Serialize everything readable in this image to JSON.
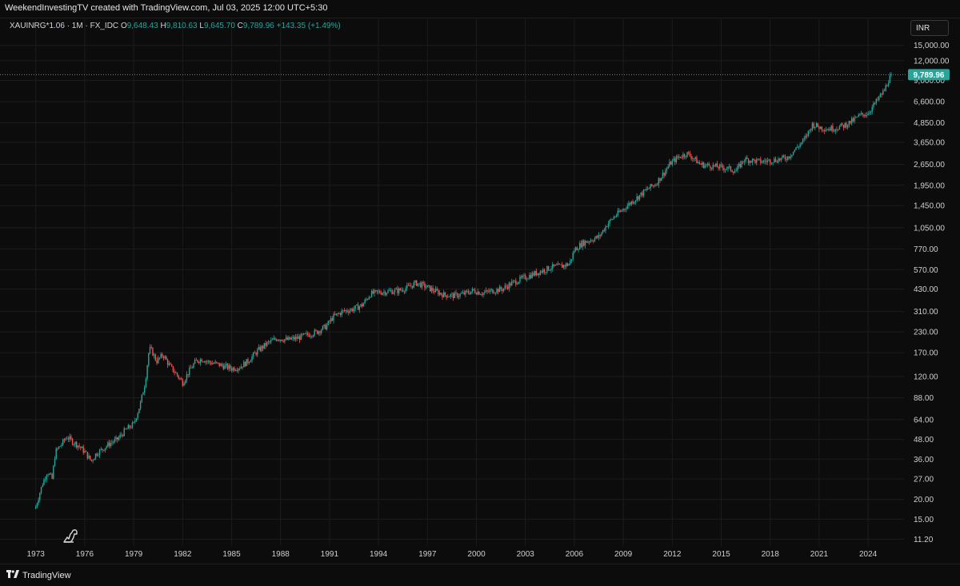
{
  "header": {
    "credit": "WeekendInvestingTV created with TradingView.com, Jul 03, 2025 12:00 UTC+5:30"
  },
  "legend": {
    "symbol": "XAUINRG*1.06 · 1M · FX_IDC",
    "open_label": "O",
    "open_value": "9,648.43",
    "high_label": "H",
    "high_value": "9,810.63",
    "low_label": "L",
    "low_value": "9,645.70",
    "close_label": "C",
    "close_value": "9,789.96",
    "change": "+143.35 (+1.49%)"
  },
  "currency_button": "INR",
  "footer": {
    "brand": "TradingView"
  },
  "colors": {
    "up": "#26a69a",
    "down": "#ef5350",
    "background": "#0c0c0c",
    "grid": "#1c1c1c",
    "price_tag": "#26a69a"
  },
  "icons": [
    "tradingview-logo-icon",
    "dino-icon"
  ],
  "chart_data": {
    "type": "candlestick",
    "scale": "log",
    "interval": "1M",
    "symbol": "XAUINRG*1.06",
    "currency": "INR",
    "last_price": 9789.96,
    "last_price_label": "9,789.96",
    "y_ticks": [
      "15,000.00",
      "12,000.00",
      "9,000.00",
      "6,600.00",
      "4,850.00",
      "3,650.00",
      "2,650.00",
      "1,950.00",
      "1,450.00",
      "1,050.00",
      "770.00",
      "570.00",
      "430.00",
      "310.00",
      "230.00",
      "170.00",
      "120.00",
      "88.00",
      "64.00",
      "48.00",
      "36.00",
      "27.00",
      "20.00",
      "15.00",
      "11.20"
    ],
    "y_values": [
      15000,
      12000,
      9000,
      6600,
      4850,
      3650,
      2650,
      1950,
      1450,
      1050,
      770,
      570,
      430,
      310,
      230,
      170,
      120,
      88,
      64,
      48,
      36,
      27,
      20,
      15,
      11.2
    ],
    "x_ticks": [
      "1973",
      "1976",
      "1979",
      "1982",
      "1985",
      "1988",
      "1991",
      "1994",
      "1997",
      "2000",
      "2003",
      "2006",
      "2009",
      "2012",
      "2015",
      "2018",
      "2021",
      "2024"
    ],
    "x_years": [
      1973,
      1976,
      1979,
      1982,
      1985,
      1988,
      1991,
      1994,
      1997,
      2000,
      2003,
      2006,
      2009,
      2012,
      2015,
      2018,
      2021,
      2024
    ],
    "ylim": [
      10.5,
      17000
    ],
    "xlim": [
      1971.2,
      2026.2
    ],
    "price_path": [
      [
        1973.0,
        18
      ],
      [
        1973.4,
        25
      ],
      [
        1973.7,
        30
      ],
      [
        1974.0,
        27
      ],
      [
        1974.2,
        40
      ],
      [
        1974.6,
        45
      ],
      [
        1974.9,
        50
      ],
      [
        1975.3,
        46
      ],
      [
        1975.6,
        44
      ],
      [
        1976.0,
        40
      ],
      [
        1976.4,
        35
      ],
      [
        1976.7,
        39
      ],
      [
        1977.0,
        41
      ],
      [
        1977.5,
        45
      ],
      [
        1978.0,
        48
      ],
      [
        1978.5,
        55
      ],
      [
        1979.0,
        60
      ],
      [
        1979.4,
        80
      ],
      [
        1979.7,
        110
      ],
      [
        1979.95,
        180
      ],
      [
        1980.1,
        175
      ],
      [
        1980.4,
        150
      ],
      [
        1980.8,
        165
      ],
      [
        1981.2,
        140
      ],
      [
        1981.6,
        125
      ],
      [
        1982.0,
        110
      ],
      [
        1982.4,
        130
      ],
      [
        1982.8,
        150
      ],
      [
        1983.2,
        155
      ],
      [
        1983.6,
        148
      ],
      [
        1984.0,
        145
      ],
      [
        1984.5,
        140
      ],
      [
        1985.0,
        135
      ],
      [
        1985.5,
        138
      ],
      [
        1986.0,
        150
      ],
      [
        1986.6,
        175
      ],
      [
        1987.2,
        195
      ],
      [
        1987.8,
        210
      ],
      [
        1988.4,
        205
      ],
      [
        1989.0,
        210
      ],
      [
        1989.6,
        220
      ],
      [
        1990.2,
        230
      ],
      [
        1990.8,
        250
      ],
      [
        1991.2,
        285
      ],
      [
        1991.8,
        310
      ],
      [
        1992.4,
        320
      ],
      [
        1993.0,
        340
      ],
      [
        1993.5,
        400
      ],
      [
        1994.0,
        410
      ],
      [
        1994.6,
        415
      ],
      [
        1995.2,
        420
      ],
      [
        1995.8,
        440
      ],
      [
        1996.3,
        470
      ],
      [
        1996.8,
        450
      ],
      [
        1997.4,
        420
      ],
      [
        1998.0,
        395
      ],
      [
        1998.6,
        390
      ],
      [
        1999.2,
        400
      ],
      [
        1999.8,
        420
      ],
      [
        2000.4,
        405
      ],
      [
        2001.0,
        420
      ],
      [
        2001.6,
        430
      ],
      [
        2002.2,
        470
      ],
      [
        2002.8,
        500
      ],
      [
        2003.4,
        530
      ],
      [
        2004.0,
        560
      ],
      [
        2004.6,
        590
      ],
      [
        2005.2,
        600
      ],
      [
        2005.7,
        620
      ],
      [
        2006.0,
        760
      ],
      [
        2006.5,
        840
      ],
      [
        2007.0,
        880
      ],
      [
        2007.5,
        920
      ],
      [
        2008.0,
        1100
      ],
      [
        2008.5,
        1250
      ],
      [
        2008.9,
        1350
      ],
      [
        2009.4,
        1500
      ],
      [
        2009.9,
        1650
      ],
      [
        2010.5,
        1850
      ],
      [
        2011.0,
        2000
      ],
      [
        2011.5,
        2350
      ],
      [
        2011.9,
        2700
      ],
      [
        2012.4,
        2950
      ],
      [
        2012.9,
        3100
      ],
      [
        2013.3,
        2900
      ],
      [
        2013.7,
        2650
      ],
      [
        2014.2,
        2600
      ],
      [
        2014.8,
        2550
      ],
      [
        2015.4,
        2500
      ],
      [
        2015.9,
        2400
      ],
      [
        2016.4,
        2850
      ],
      [
        2016.9,
        2800
      ],
      [
        2017.5,
        2750
      ],
      [
        2018.0,
        2800
      ],
      [
        2018.6,
        2850
      ],
      [
        2019.1,
        2950
      ],
      [
        2019.6,
        3350
      ],
      [
        2020.1,
        3800
      ],
      [
        2020.6,
        4750
      ],
      [
        2021.0,
        4550
      ],
      [
        2021.5,
        4450
      ],
      [
        2022.0,
        4500
      ],
      [
        2022.5,
        4650
      ],
      [
        2023.0,
        4950
      ],
      [
        2023.5,
        5400
      ],
      [
        2024.0,
        5600
      ],
      [
        2024.5,
        6600
      ],
      [
        2025.0,
        7800
      ],
      [
        2025.3,
        9300
      ],
      [
        2025.45,
        9790
      ]
    ]
  }
}
